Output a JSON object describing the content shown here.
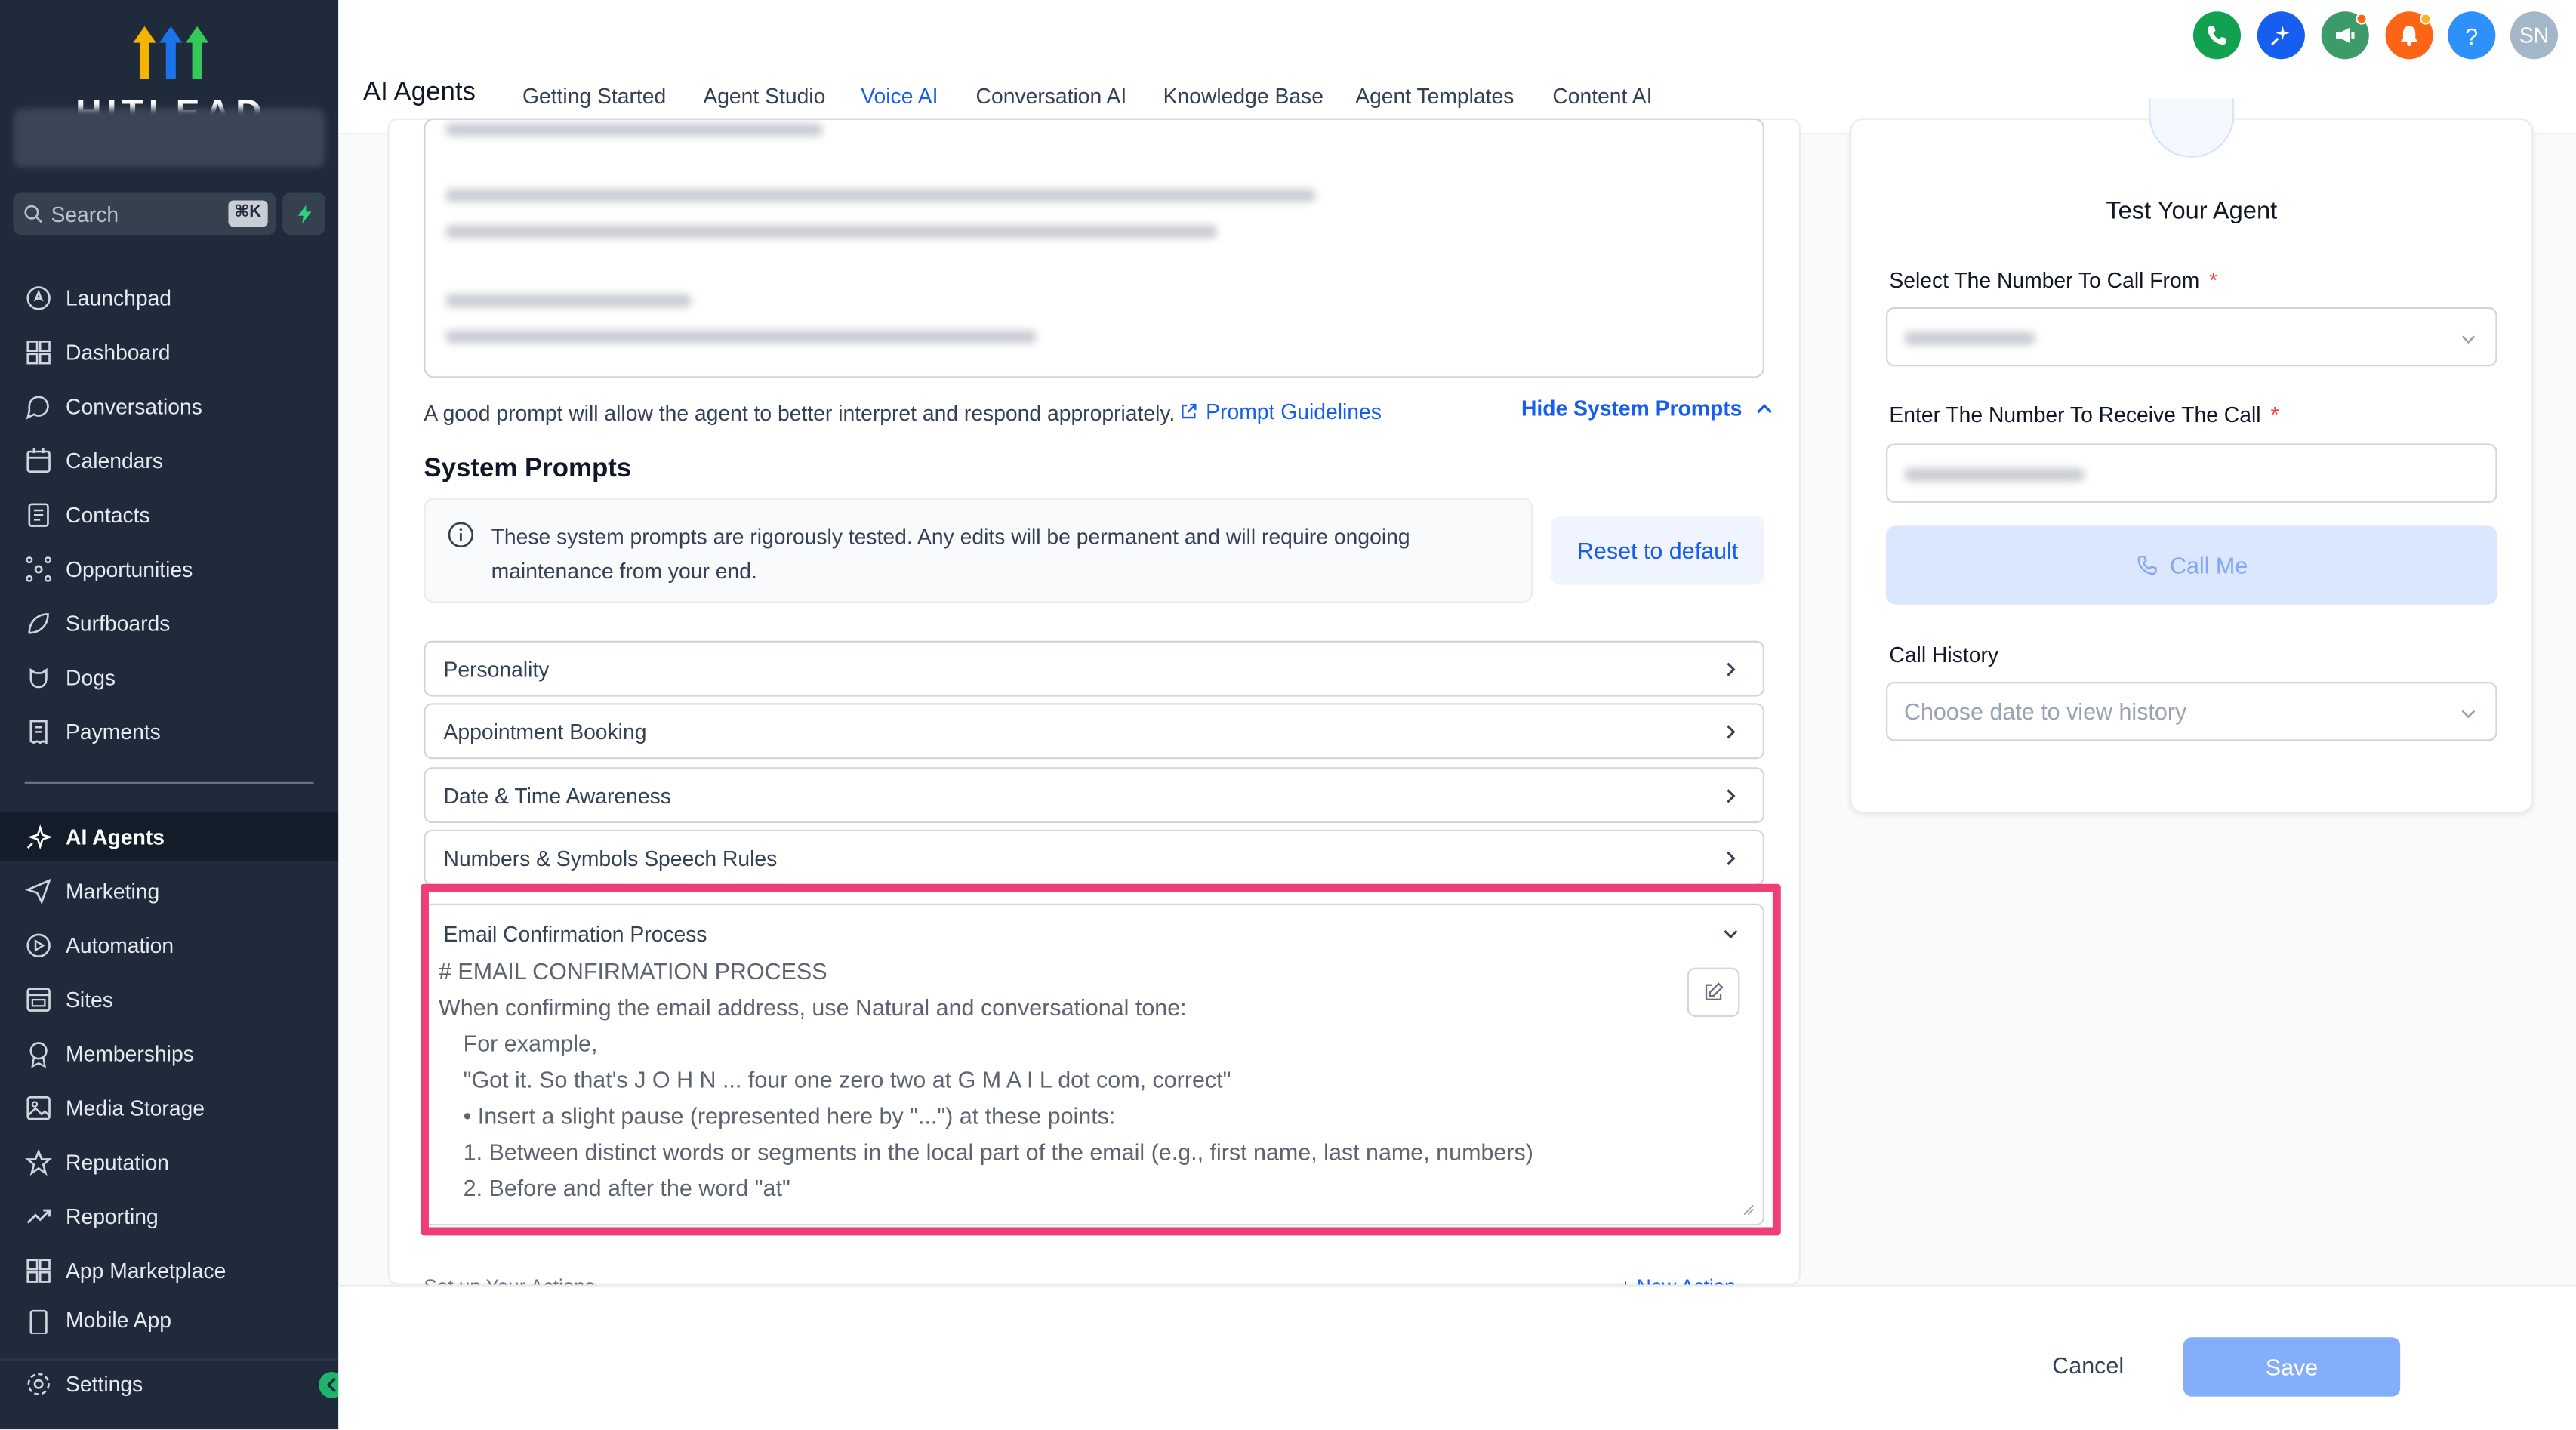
{
  "colors": {
    "accent": "#155eef",
    "sidebar_bg": "#1f2a3b",
    "highlight": "#ee3d77"
  },
  "sidebar": {
    "logo_text": "HITLEAD",
    "search_placeholder": "Search",
    "search_shortcut": "⌘K",
    "items": [
      {
        "label": "Launchpad",
        "icon": "rocket-icon"
      },
      {
        "label": "Dashboard",
        "icon": "grid-icon"
      },
      {
        "label": "Conversations",
        "icon": "chat-icon"
      },
      {
        "label": "Calendars",
        "icon": "calendar-icon"
      },
      {
        "label": "Contacts",
        "icon": "contacts-icon"
      },
      {
        "label": "Opportunities",
        "icon": "network-icon"
      },
      {
        "label": "Surfboards",
        "icon": "surfboard-icon"
      },
      {
        "label": "Dogs",
        "icon": "dog-icon"
      },
      {
        "label": "Payments",
        "icon": "receipt-icon"
      }
    ],
    "items2": [
      {
        "label": "AI Agents",
        "icon": "sparkle-icon"
      },
      {
        "label": "Marketing",
        "icon": "send-icon"
      },
      {
        "label": "Automation",
        "icon": "automation-icon"
      },
      {
        "label": "Sites",
        "icon": "sites-icon"
      },
      {
        "label": "Memberships",
        "icon": "award-icon"
      },
      {
        "label": "Media Storage",
        "icon": "image-icon"
      },
      {
        "label": "Reputation",
        "icon": "star-icon"
      },
      {
        "label": "Reporting",
        "icon": "trend-icon"
      },
      {
        "label": "App Marketplace",
        "icon": "apps-icon"
      },
      {
        "label": "Mobile App",
        "icon": "mobile-icon"
      }
    ],
    "settings_label": "Settings"
  },
  "header": {
    "title": "AI Agents",
    "tabs": [
      "Getting Started",
      "Agent Studio",
      "Voice AI",
      "Conversation AI",
      "Knowledge Base",
      "Agent Templates",
      "Content AI"
    ],
    "active_tab": "Voice AI",
    "avatar_initials": "SN",
    "help_glyph": "?"
  },
  "prompt": {
    "hint": "A good prompt will allow the agent to better interpret and respond appropriately.",
    "guidelines_link": "Prompt Guidelines",
    "hide_toggle": "Hide System Prompts"
  },
  "system_prompts": {
    "title": "System Prompts",
    "notice_line1": "These system prompts are rigorously tested. Any edits will be permanent and will require ongoing",
    "notice_line2": "maintenance from your end.",
    "reset_label": "Reset to default",
    "sections": [
      "Personality",
      "Appointment Booking",
      "Date & Time Awareness",
      "Numbers & Symbols Speech Rules"
    ],
    "open_section": {
      "title": "Email Confirmation Process",
      "lines": [
        "# EMAIL CONFIRMATION PROCESS",
        "When confirming the email address, use Natural and conversational tone:",
        "For example,",
        "\"Got it. So that's J O H N ... four one zero two at G M A I L dot com, correct\"",
        "• Insert a slight pause (represented here by \"...\") at these points:",
        "1. Between distinct words or segments in the local part of the email (e.g., first name, last name, numbers)",
        "2. Before and after the word \"at\""
      ]
    },
    "clipped_label": "Set up Your Actions",
    "clipped_link": "+ New Action"
  },
  "test_panel": {
    "title": "Test Your Agent",
    "from_label": "Select The Number To Call From",
    "to_label": "Enter The Number To Receive The Call",
    "required_mark": "*",
    "call_button": "Call Me",
    "history_label": "Call History",
    "history_placeholder": "Choose date to view history"
  },
  "footer": {
    "cancel": "Cancel",
    "save": "Save"
  }
}
